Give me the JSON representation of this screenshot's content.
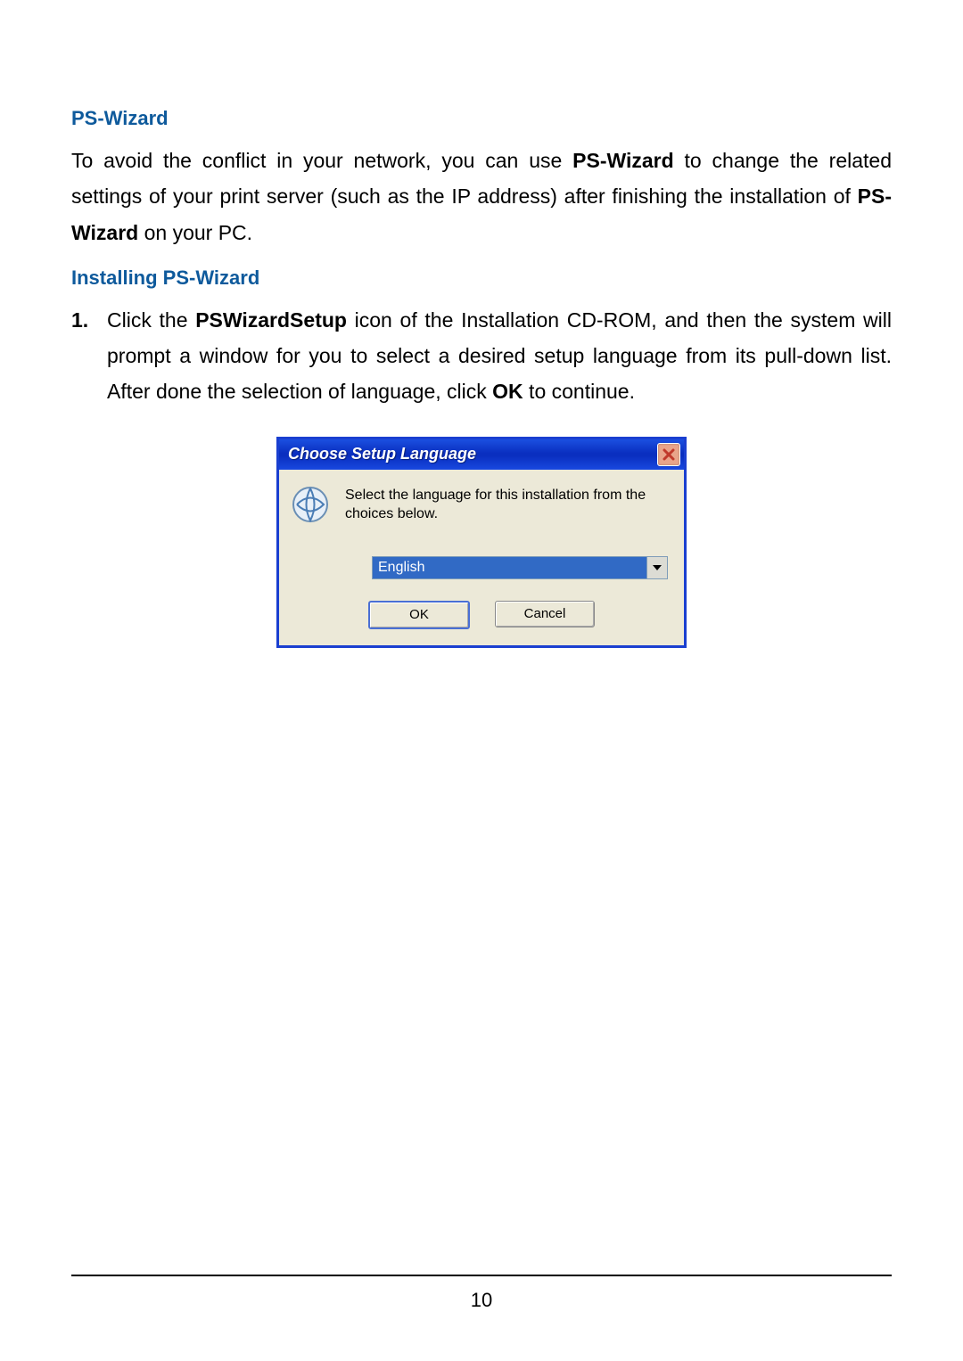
{
  "headings": {
    "h1": "PS-Wizard",
    "h2": "Installing PS-Wizard"
  },
  "paragraph1": {
    "part1": "To avoid the conflict in your network, you can use ",
    "bold1": "PS-Wizard",
    "part2": " to change the related settings of your print server (such as the IP address) after finishing the installation of ",
    "bold2": "PS-Wizard",
    "part3": " on your PC."
  },
  "list": {
    "item1": {
      "num": "1.",
      "part1": "Click the ",
      "bold1": "PSWizardSetup",
      "part2": " icon of the Installation CD-ROM, and then the system will prompt a window for you to select a desired setup language from its pull-down list. After done the selection of language, click ",
      "bold2": "OK",
      "part3": " to continue."
    }
  },
  "dialog": {
    "title": "Choose Setup Language",
    "instruction": "Select the language for this installation from the choices below.",
    "selected": "English",
    "ok": "OK",
    "cancel": "Cancel"
  },
  "page_number": "10"
}
